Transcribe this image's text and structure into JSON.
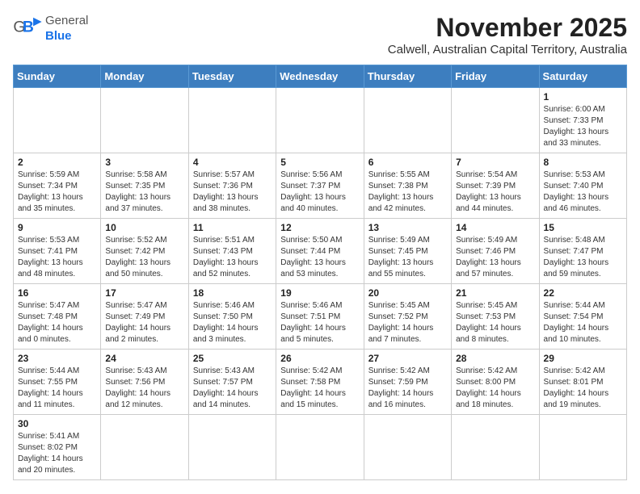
{
  "header": {
    "logo_general": "General",
    "logo_blue": "Blue",
    "month_title": "November 2025",
    "location": "Calwell, Australian Capital Territory, Australia"
  },
  "weekdays": [
    "Sunday",
    "Monday",
    "Tuesday",
    "Wednesday",
    "Thursday",
    "Friday",
    "Saturday"
  ],
  "weeks": [
    [
      {
        "day": "",
        "info": ""
      },
      {
        "day": "",
        "info": ""
      },
      {
        "day": "",
        "info": ""
      },
      {
        "day": "",
        "info": ""
      },
      {
        "day": "",
        "info": ""
      },
      {
        "day": "",
        "info": ""
      },
      {
        "day": "1",
        "info": "Sunrise: 6:00 AM\nSunset: 7:33 PM\nDaylight: 13 hours\nand 33 minutes."
      }
    ],
    [
      {
        "day": "2",
        "info": "Sunrise: 5:59 AM\nSunset: 7:34 PM\nDaylight: 13 hours\nand 35 minutes."
      },
      {
        "day": "3",
        "info": "Sunrise: 5:58 AM\nSunset: 7:35 PM\nDaylight: 13 hours\nand 37 minutes."
      },
      {
        "day": "4",
        "info": "Sunrise: 5:57 AM\nSunset: 7:36 PM\nDaylight: 13 hours\nand 38 minutes."
      },
      {
        "day": "5",
        "info": "Sunrise: 5:56 AM\nSunset: 7:37 PM\nDaylight: 13 hours\nand 40 minutes."
      },
      {
        "day": "6",
        "info": "Sunrise: 5:55 AM\nSunset: 7:38 PM\nDaylight: 13 hours\nand 42 minutes."
      },
      {
        "day": "7",
        "info": "Sunrise: 5:54 AM\nSunset: 7:39 PM\nDaylight: 13 hours\nand 44 minutes."
      },
      {
        "day": "8",
        "info": "Sunrise: 5:53 AM\nSunset: 7:40 PM\nDaylight: 13 hours\nand 46 minutes."
      }
    ],
    [
      {
        "day": "9",
        "info": "Sunrise: 5:53 AM\nSunset: 7:41 PM\nDaylight: 13 hours\nand 48 minutes."
      },
      {
        "day": "10",
        "info": "Sunrise: 5:52 AM\nSunset: 7:42 PM\nDaylight: 13 hours\nand 50 minutes."
      },
      {
        "day": "11",
        "info": "Sunrise: 5:51 AM\nSunset: 7:43 PM\nDaylight: 13 hours\nand 52 minutes."
      },
      {
        "day": "12",
        "info": "Sunrise: 5:50 AM\nSunset: 7:44 PM\nDaylight: 13 hours\nand 53 minutes."
      },
      {
        "day": "13",
        "info": "Sunrise: 5:49 AM\nSunset: 7:45 PM\nDaylight: 13 hours\nand 55 minutes."
      },
      {
        "day": "14",
        "info": "Sunrise: 5:49 AM\nSunset: 7:46 PM\nDaylight: 13 hours\nand 57 minutes."
      },
      {
        "day": "15",
        "info": "Sunrise: 5:48 AM\nSunset: 7:47 PM\nDaylight: 13 hours\nand 59 minutes."
      }
    ],
    [
      {
        "day": "16",
        "info": "Sunrise: 5:47 AM\nSunset: 7:48 PM\nDaylight: 14 hours\nand 0 minutes."
      },
      {
        "day": "17",
        "info": "Sunrise: 5:47 AM\nSunset: 7:49 PM\nDaylight: 14 hours\nand 2 minutes."
      },
      {
        "day": "18",
        "info": "Sunrise: 5:46 AM\nSunset: 7:50 PM\nDaylight: 14 hours\nand 3 minutes."
      },
      {
        "day": "19",
        "info": "Sunrise: 5:46 AM\nSunset: 7:51 PM\nDaylight: 14 hours\nand 5 minutes."
      },
      {
        "day": "20",
        "info": "Sunrise: 5:45 AM\nSunset: 7:52 PM\nDaylight: 14 hours\nand 7 minutes."
      },
      {
        "day": "21",
        "info": "Sunrise: 5:45 AM\nSunset: 7:53 PM\nDaylight: 14 hours\nand 8 minutes."
      },
      {
        "day": "22",
        "info": "Sunrise: 5:44 AM\nSunset: 7:54 PM\nDaylight: 14 hours\nand 10 minutes."
      }
    ],
    [
      {
        "day": "23",
        "info": "Sunrise: 5:44 AM\nSunset: 7:55 PM\nDaylight: 14 hours\nand 11 minutes."
      },
      {
        "day": "24",
        "info": "Sunrise: 5:43 AM\nSunset: 7:56 PM\nDaylight: 14 hours\nand 12 minutes."
      },
      {
        "day": "25",
        "info": "Sunrise: 5:43 AM\nSunset: 7:57 PM\nDaylight: 14 hours\nand 14 minutes."
      },
      {
        "day": "26",
        "info": "Sunrise: 5:42 AM\nSunset: 7:58 PM\nDaylight: 14 hours\nand 15 minutes."
      },
      {
        "day": "27",
        "info": "Sunrise: 5:42 AM\nSunset: 7:59 PM\nDaylight: 14 hours\nand 16 minutes."
      },
      {
        "day": "28",
        "info": "Sunrise: 5:42 AM\nSunset: 8:00 PM\nDaylight: 14 hours\nand 18 minutes."
      },
      {
        "day": "29",
        "info": "Sunrise: 5:42 AM\nSunset: 8:01 PM\nDaylight: 14 hours\nand 19 minutes."
      }
    ],
    [
      {
        "day": "30",
        "info": "Sunrise: 5:41 AM\nSunset: 8:02 PM\nDaylight: 14 hours\nand 20 minutes."
      },
      {
        "day": "",
        "info": ""
      },
      {
        "day": "",
        "info": ""
      },
      {
        "day": "",
        "info": ""
      },
      {
        "day": "",
        "info": ""
      },
      {
        "day": "",
        "info": ""
      },
      {
        "day": "",
        "info": ""
      }
    ]
  ]
}
